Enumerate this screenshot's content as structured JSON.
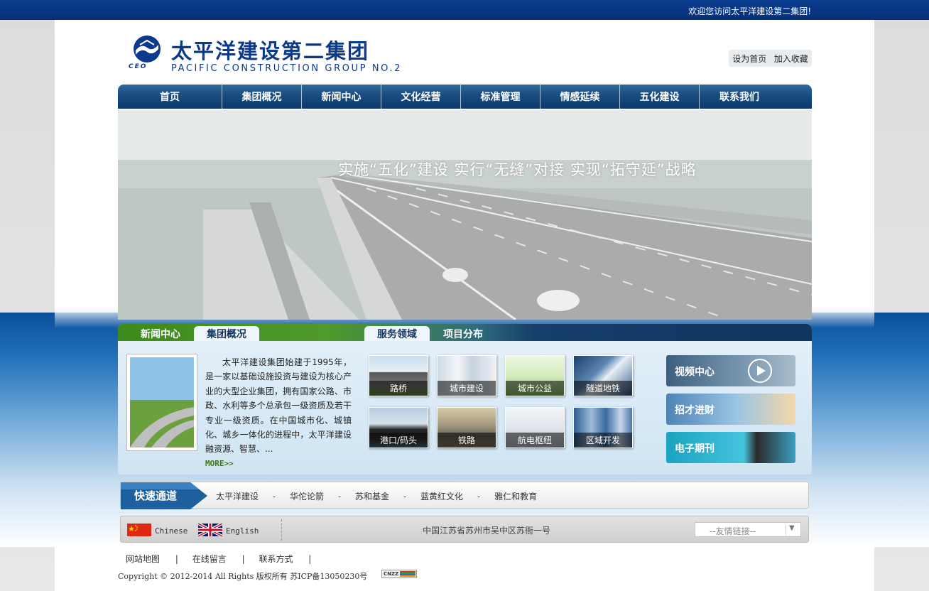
{
  "topbar": {
    "welcome": "欢迎您访问太平洋建设第二集团!"
  },
  "header": {
    "logo_cn": "太平洋建设第二集团",
    "logo_en": "PACIFIC CONSTRUCTION GROUP NO.2",
    "logo_ceo": "CEO",
    "set_home": "设为首页",
    "add_favorite": "加入收藏"
  },
  "nav": {
    "items": [
      {
        "label": "首页"
      },
      {
        "label": "集团概况"
      },
      {
        "label": "新闻中心"
      },
      {
        "label": "文化经营"
      },
      {
        "label": "标准管理"
      },
      {
        "label": "情感延续"
      },
      {
        "label": "五化建设"
      },
      {
        "label": "联系我们"
      }
    ]
  },
  "banner": {
    "slogan": "实施“五化”建设  实行“无缝”对接  实现“拓守延”战略"
  },
  "panel": {
    "tabs_left": [
      "新闻中心",
      "集团概况"
    ],
    "tabs_right": [
      "服务领域",
      "项目分布"
    ],
    "about_text": "太平洋建设集团始建于1995年，是一家以基础设施投资与建设为核心产业的大型企业集团，拥有国家公路、市政、水利等多个总承包一级资质及若干专业一级资质。在中国城市化、城镇化、城乡一体化的进程中，太平洋建设融资源、智慧、...",
    "more": "MORE>>",
    "services": [
      "路桥",
      "城市建设",
      "城市公益",
      "隧道地铁",
      "港口/码头",
      "铁路",
      "航电枢纽",
      "区域开发"
    ],
    "side": [
      "视频中心",
      "招才进财",
      "电子期刊"
    ]
  },
  "quick": {
    "title": "快速通道",
    "links": [
      "太平洋建设",
      "华佗论箭",
      "苏和基金",
      "蓝黄红文化",
      "雅仁和教育"
    ],
    "sep": "-"
  },
  "langbar": {
    "chinese": "Chinese",
    "english": "English",
    "address": "中国江苏省苏州市吴中区苏衙一号",
    "friend_links": "--友情链接--"
  },
  "footer": {
    "links": [
      "网站地图",
      "在线留言",
      "联系方式"
    ],
    "sep": "|",
    "copyright": "Copyright © 2012-2014 All Rights 版权所有 苏ICP备13050230号",
    "cnzz": "CNZZ"
  },
  "colors": {
    "topbar": "#0a3d8f",
    "nav": "#1a4e82",
    "logo": "#0b3a8c",
    "green_tab": "#4f9a2a"
  }
}
